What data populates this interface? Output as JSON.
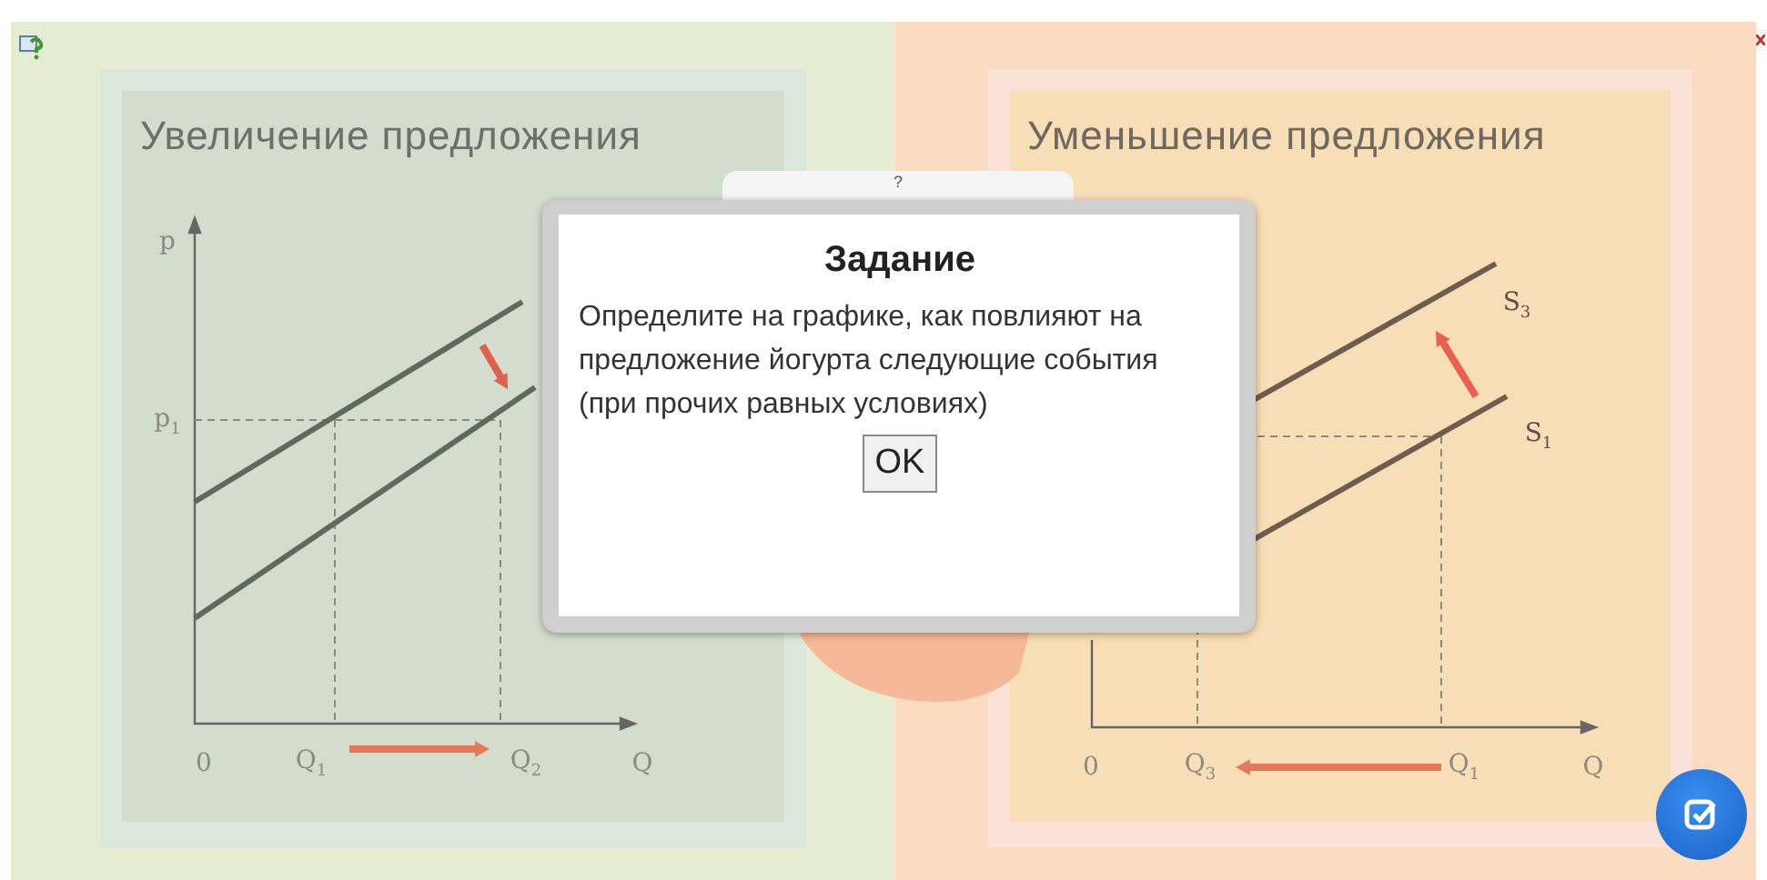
{
  "panels": [
    {
      "kind": "increase",
      "title": "Увеличение предложения",
      "labels": [
        "p",
        "p$_{1}$",
        "0",
        "Q$_{1}$",
        "Q$_{2}$",
        "Q"
      ]
    },
    {
      "kind": "decrease",
      "title": "Уменьшение предложения",
      "labels": [
        "S$_{3}$",
        "S$_{1}$",
        "0",
        "Q$_{3}$",
        "Q$_{1}$",
        "Q"
      ]
    }
  ],
  "help_tab": {
    "label": "?"
  },
  "dialog": {
    "title": "Задание",
    "text": "Определите на графике, как повлияют на предложение йогурта следующие события (при прочих равных условиях)",
    "button": "OK"
  }
}
